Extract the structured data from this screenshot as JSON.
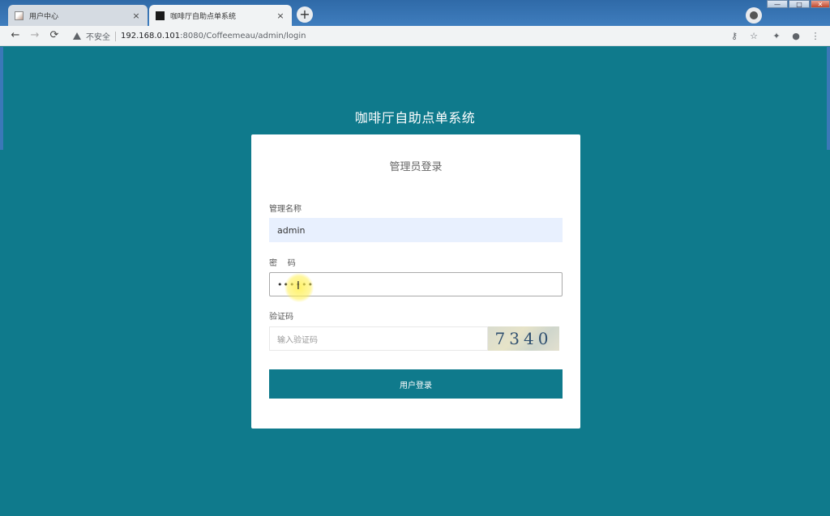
{
  "browser": {
    "tabs": [
      {
        "title": "用户中心",
        "close": "×"
      },
      {
        "title": "咖啡厅自助点单系统",
        "close": "×"
      }
    ],
    "new_tab": "+",
    "window_controls": {
      "min": "—",
      "max": "□",
      "close": "✕"
    },
    "nav": {
      "back": "←",
      "forward": "→",
      "reload": "⟳"
    },
    "address": {
      "security_label": "不安全",
      "host": "192.168.0.101",
      "rest": ":8080/Coffeemeau/admin/login"
    },
    "toolbar_icons": {
      "key": "⚷",
      "star": "☆",
      "extension": "✦",
      "account": "●",
      "menu": "⋮"
    }
  },
  "page": {
    "system_title": "咖啡厅自助点单系统",
    "login_title": "管理员登录",
    "username_label": "管理名称",
    "username_value": "admin",
    "password_label": "密    码",
    "password_value": "••••••",
    "captcha_label": "验证码",
    "captcha_placeholder": "输入验证码",
    "captcha_text": "7340",
    "submit_label": "用户登录",
    "ibeam": "I"
  },
  "colors": {
    "page_bg": "#0f7a8c",
    "button_bg": "#0f7a8c",
    "autofill_bg": "#e8f0fe"
  }
}
